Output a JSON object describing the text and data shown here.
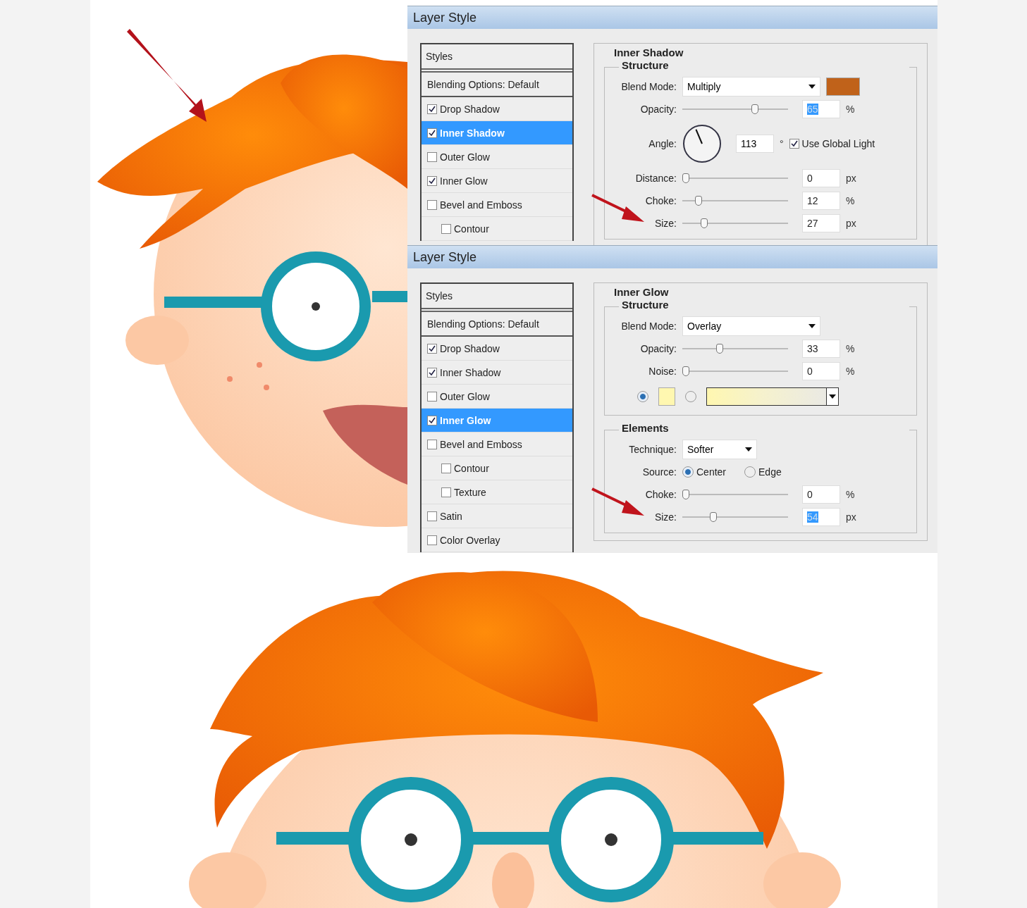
{
  "dialogs": [
    {
      "title": "Layer Style",
      "styles_header": "Styles",
      "blending_options": "Blending Options: Default",
      "style_items": [
        {
          "label": "Drop Shadow",
          "checked": true,
          "selected": false
        },
        {
          "label": "Inner Shadow",
          "checked": true,
          "selected": true
        },
        {
          "label": "Outer Glow",
          "checked": false,
          "selected": false
        },
        {
          "label": "Inner Glow",
          "checked": true,
          "selected": false
        },
        {
          "label": "Bevel and Emboss",
          "checked": false,
          "selected": false,
          "children": [
            {
              "label": "Contour",
              "checked": false,
              "selected": false
            }
          ]
        }
      ],
      "panel_title": "Inner Shadow",
      "groups": [
        {
          "title": "Structure",
          "rows": [
            {
              "kind": "blend",
              "label": "Blend Mode:",
              "value": "Multiply",
              "color": "#c0621a"
            },
            {
              "kind": "slider",
              "label": "Opacity:",
              "level": 0.65,
              "value": "65",
              "unit": "%",
              "selected": true,
              "arrow": false
            },
            {
              "kind": "angle",
              "label": "Angle:",
              "value": "113",
              "unit": "°",
              "checkbox": {
                "label": "Use Global Light",
                "checked": true
              }
            },
            {
              "kind": "slider",
              "label": "Distance:",
              "level": 0,
              "value": "0",
              "unit": "px",
              "selected": false,
              "arrow": false
            },
            {
              "kind": "slider",
              "label": "Choke:",
              "level": 0.12,
              "value": "12",
              "unit": "%",
              "selected": false,
              "arrow": false
            },
            {
              "kind": "slider",
              "label": "Size:",
              "level": 0.17,
              "value": "27",
              "unit": "px",
              "selected": false,
              "arrow": true
            }
          ]
        }
      ]
    },
    {
      "title": "Layer Style",
      "styles_header": "Styles",
      "blending_options": "Blending Options: Default",
      "style_items": [
        {
          "label": "Drop Shadow",
          "checked": true,
          "selected": false
        },
        {
          "label": "Inner Shadow",
          "checked": true,
          "selected": false
        },
        {
          "label": "Outer Glow",
          "checked": false,
          "selected": false
        },
        {
          "label": "Inner Glow",
          "checked": true,
          "selected": true
        },
        {
          "label": "Bevel and Emboss",
          "checked": false,
          "selected": false,
          "children": [
            {
              "label": "Contour",
              "checked": false,
              "selected": false
            },
            {
              "label": "Texture",
              "checked": false,
              "selected": false
            }
          ]
        },
        {
          "label": "Satin",
          "checked": false,
          "selected": false
        },
        {
          "label": "Color Overlay",
          "checked": false,
          "selected": false
        }
      ],
      "panel_title": "Inner Glow",
      "groups": [
        {
          "title": "Structure",
          "rows": [
            {
              "kind": "blend",
              "label": "Blend Mode:",
              "value": "Overlay"
            },
            {
              "kind": "slider",
              "label": "Opacity:",
              "level": 0.32,
              "value": "33",
              "unit": "%",
              "selected": false,
              "arrow": false
            },
            {
              "kind": "slider",
              "label": "Noise:",
              "level": 0,
              "value": "0",
              "unit": "%",
              "selected": false,
              "arrow": false
            },
            {
              "kind": "color_choice",
              "options": [
                {
                  "kind": "swatch",
                  "selected": true,
                  "color": "#fff7b0"
                },
                {
                  "kind": "gradient",
                  "selected": false,
                  "color": "#fff7b0"
                }
              ]
            }
          ]
        },
        {
          "title": "Elements",
          "rows": [
            {
              "kind": "dropdown",
              "label": "Technique:",
              "value": "Softer"
            },
            {
              "kind": "radios",
              "label": "Source:",
              "options": [
                {
                  "label": "Center",
                  "selected": true
                },
                {
                  "label": "Edge",
                  "selected": false
                }
              ]
            },
            {
              "kind": "slider",
              "label": "Choke:",
              "level": 0,
              "value": "0",
              "unit": "%",
              "selected": false,
              "arrow": false
            },
            {
              "kind": "slider",
              "label": "Size:",
              "level": 0.26,
              "value": "54",
              "unit": "px",
              "selected": true,
              "arrow": true
            }
          ]
        }
      ]
    }
  ]
}
